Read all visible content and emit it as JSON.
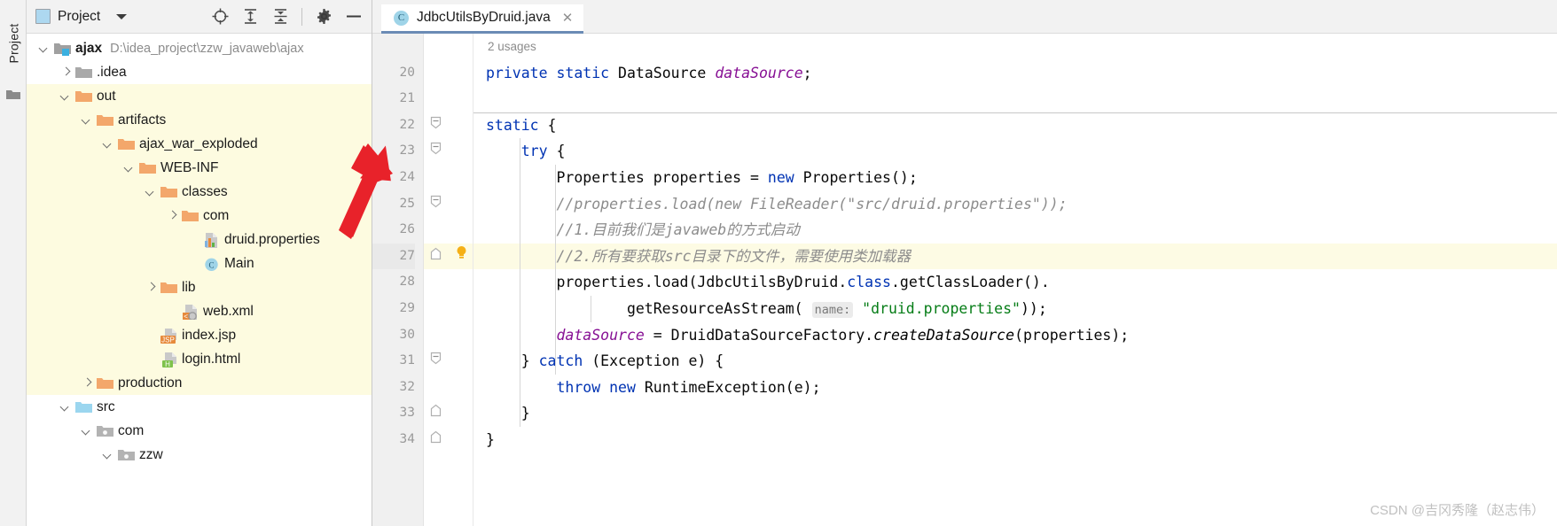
{
  "window": {
    "tool_strip_label": "Project"
  },
  "panel": {
    "title": "Project",
    "icons": {
      "project_square": "project-square-icon",
      "dropdown": "chevron-down-icon",
      "locate": "target-locate-icon",
      "expand_all": "expand-all-icon",
      "collapse_all": "collapse-all-icon",
      "settings": "gear-icon",
      "hide": "minimize-icon"
    }
  },
  "tree": [
    {
      "label": "ajax",
      "sub": "D:\\idea_project\\zzw_javaweb\\ajax",
      "depth": 0,
      "arrow": "down",
      "icon": "module-folder-icon",
      "bold": true,
      "highlight": false
    },
    {
      "label": ".idea",
      "sub": "",
      "depth": 1,
      "arrow": "right",
      "icon": "gray-folder-icon",
      "bold": false,
      "highlight": false
    },
    {
      "label": "out",
      "sub": "",
      "depth": 1,
      "arrow": "down",
      "icon": "orange-folder-icon",
      "bold": false,
      "highlight": true
    },
    {
      "label": "artifacts",
      "sub": "",
      "depth": 2,
      "arrow": "down",
      "icon": "orange-folder-icon",
      "bold": false,
      "highlight": true
    },
    {
      "label": "ajax_war_exploded",
      "sub": "",
      "depth": 3,
      "arrow": "down",
      "icon": "orange-folder-icon",
      "bold": false,
      "highlight": true
    },
    {
      "label": "WEB-INF",
      "sub": "",
      "depth": 4,
      "arrow": "down",
      "icon": "orange-folder-icon",
      "bold": false,
      "highlight": true
    },
    {
      "label": "classes",
      "sub": "",
      "depth": 5,
      "arrow": "down",
      "icon": "orange-folder-icon",
      "bold": false,
      "highlight": true
    },
    {
      "label": "com",
      "sub": "",
      "depth": 6,
      "arrow": "right",
      "icon": "orange-folder-icon",
      "bold": false,
      "highlight": true
    },
    {
      "label": "druid.properties",
      "sub": "",
      "depth": 7,
      "arrow": "none",
      "icon": "properties-file-icon",
      "bold": false,
      "highlight": true
    },
    {
      "label": "Main",
      "sub": "",
      "depth": 7,
      "arrow": "none",
      "icon": "java-class-icon",
      "bold": false,
      "highlight": true
    },
    {
      "label": "lib",
      "sub": "",
      "depth": 5,
      "arrow": "right",
      "icon": "orange-folder-icon",
      "bold": false,
      "highlight": true
    },
    {
      "label": "web.xml",
      "sub": "",
      "depth": 6,
      "arrow": "none",
      "icon": "xml-file-icon",
      "bold": false,
      "highlight": true
    },
    {
      "label": "index.jsp",
      "sub": "",
      "depth": 5,
      "arrow": "none",
      "icon": "jsp-file-icon",
      "bold": false,
      "highlight": true
    },
    {
      "label": "login.html",
      "sub": "",
      "depth": 5,
      "arrow": "none",
      "icon": "html-file-icon",
      "bold": false,
      "highlight": true
    },
    {
      "label": "production",
      "sub": "",
      "depth": 2,
      "arrow": "right",
      "icon": "orange-folder-icon",
      "bold": false,
      "highlight": true
    },
    {
      "label": "src",
      "sub": "",
      "depth": 1,
      "arrow": "down",
      "icon": "source-folder-icon",
      "bold": false,
      "highlight": false
    },
    {
      "label": "com",
      "sub": "",
      "depth": 2,
      "arrow": "down",
      "icon": "package-folder-icon",
      "bold": false,
      "highlight": false
    },
    {
      "label": "zzw",
      "sub": "",
      "depth": 3,
      "arrow": "down",
      "icon": "package-folder-icon",
      "bold": false,
      "highlight": false
    }
  ],
  "editor": {
    "tab": {
      "label": "JdbcUtilsByDruid.java",
      "badge": "C",
      "close": "✕"
    },
    "inlay_usages": "2 usages",
    "lines": [
      {
        "num": "20",
        "fold": "none",
        "bulb": false,
        "highlight": false,
        "tokens": [
          {
            "t": "private",
            "c": "kw"
          },
          {
            "t": " ",
            "c": "plain"
          },
          {
            "t": "static",
            "c": "kw"
          },
          {
            "t": " DataSource ",
            "c": "plain"
          },
          {
            "t": "dataSource",
            "c": "fieldv"
          },
          {
            "t": ";",
            "c": "plain"
          }
        ]
      },
      {
        "num": "21",
        "fold": "none",
        "bulb": false,
        "highlight": false,
        "tokens": []
      },
      {
        "num": "22",
        "fold": "open",
        "bulb": false,
        "highlight": false,
        "tokens": [
          {
            "t": "static",
            "c": "kw"
          },
          {
            "t": " {",
            "c": "plain"
          }
        ]
      },
      {
        "num": "23",
        "fold": "open",
        "bulb": false,
        "highlight": false,
        "tokens": [
          {
            "t": "    ",
            "c": "plain"
          },
          {
            "t": "try",
            "c": "kw"
          },
          {
            "t": " {",
            "c": "plain"
          }
        ]
      },
      {
        "num": "24",
        "fold": "none",
        "bulb": false,
        "highlight": false,
        "tokens": [
          {
            "t": "        Properties properties = ",
            "c": "plain"
          },
          {
            "t": "new",
            "c": "kw"
          },
          {
            "t": " Properties();",
            "c": "plain"
          }
        ]
      },
      {
        "num": "25",
        "fold": "open",
        "bulb": false,
        "highlight": false,
        "tokens": [
          {
            "t": "        //properties.load(new FileReader(\"src/druid.properties\"));",
            "c": "cmt"
          }
        ]
      },
      {
        "num": "26",
        "fold": "none",
        "bulb": false,
        "highlight": false,
        "tokens": [
          {
            "t": "        //1.目前我们是javaweb的方式启动",
            "c": "cmt"
          }
        ]
      },
      {
        "num": "27",
        "fold": "close",
        "bulb": true,
        "highlight": true,
        "tokens": [
          {
            "t": "        //2.所有要获取src目录下的文件，需要使用类加载器",
            "c": "cmt"
          }
        ]
      },
      {
        "num": "28",
        "fold": "none",
        "bulb": false,
        "highlight": false,
        "tokens": [
          {
            "t": "        properties.load(JdbcUtilsByDruid.",
            "c": "plain"
          },
          {
            "t": "class",
            "c": "kw"
          },
          {
            "t": ".getClassLoader().",
            "c": "plain"
          }
        ]
      },
      {
        "num": "29",
        "fold": "none",
        "bulb": false,
        "highlight": false,
        "tokens": [
          {
            "t": "                getResourceAsStream( ",
            "c": "plain"
          },
          {
            "t": "name:",
            "c": "hint"
          },
          {
            "t": " ",
            "c": "plain"
          },
          {
            "t": "\"druid.properties\"",
            "c": "str"
          },
          {
            "t": "));",
            "c": "plain"
          }
        ]
      },
      {
        "num": "30",
        "fold": "none",
        "bulb": false,
        "highlight": false,
        "tokens": [
          {
            "t": "        ",
            "c": "plain"
          },
          {
            "t": "dataSource",
            "c": "fieldv"
          },
          {
            "t": " = DruidDataSourceFactory.",
            "c": "plain"
          },
          {
            "t": "createDataSource",
            "c": "meth"
          },
          {
            "t": "(properties);",
            "c": "plain"
          }
        ]
      },
      {
        "num": "31",
        "fold": "open",
        "bulb": false,
        "highlight": false,
        "tokens": [
          {
            "t": "    } ",
            "c": "plain"
          },
          {
            "t": "catch",
            "c": "kw"
          },
          {
            "t": " (Exception e) {",
            "c": "plain"
          }
        ]
      },
      {
        "num": "32",
        "fold": "none",
        "bulb": false,
        "highlight": false,
        "tokens": [
          {
            "t": "        ",
            "c": "plain"
          },
          {
            "t": "throw",
            "c": "kw"
          },
          {
            "t": " ",
            "c": "plain"
          },
          {
            "t": "new",
            "c": "kw"
          },
          {
            "t": " RuntimeException(e);",
            "c": "plain"
          }
        ]
      },
      {
        "num": "33",
        "fold": "close",
        "bulb": false,
        "highlight": false,
        "tokens": [
          {
            "t": "    }",
            "c": "plain"
          }
        ]
      },
      {
        "num": "34",
        "fold": "close",
        "bulb": false,
        "highlight": false,
        "tokens": [
          {
            "t": "}",
            "c": "plain"
          }
        ]
      }
    ]
  },
  "annotation": {
    "arrow": "red-arrow-pointer"
  },
  "watermark": "CSDN @吉冈秀隆（赵志伟）",
  "colors": {
    "highlight_yellow": "#fdfbe0",
    "arrow_red": "#e8222a",
    "keyword_blue": "#0033b3",
    "string_green": "#067d17",
    "field_purple": "#871094",
    "comment_gray": "#8c8c8c",
    "tab_underline": "#6b8bb5",
    "folder_orange": "#f3a76b"
  }
}
